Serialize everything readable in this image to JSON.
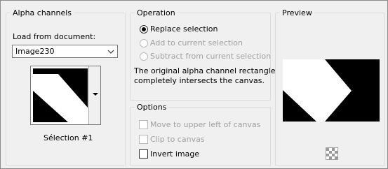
{
  "alpha_channels": {
    "title": "Alpha channels",
    "load_label": "Load from document:",
    "document_value": "Image230",
    "selection_name": "Sélection #1"
  },
  "operation": {
    "title": "Operation",
    "options": [
      {
        "label": "Replace selection",
        "selected": true,
        "enabled": true
      },
      {
        "label": "Add to current selection",
        "selected": false,
        "enabled": false
      },
      {
        "label": "Subtract from current selection",
        "selected": false,
        "enabled": false
      }
    ],
    "message": [
      "The original alpha channel rectangle",
      "completely intersects the canvas."
    ]
  },
  "options": {
    "title": "Options",
    "items": [
      {
        "label": "Move to upper left of canvas",
        "checked": false,
        "enabled": false
      },
      {
        "label": "Clip to canvas",
        "checked": false,
        "enabled": false
      },
      {
        "label": "Invert image",
        "checked": false,
        "enabled": true
      }
    ]
  },
  "preview": {
    "title": "Preview"
  }
}
